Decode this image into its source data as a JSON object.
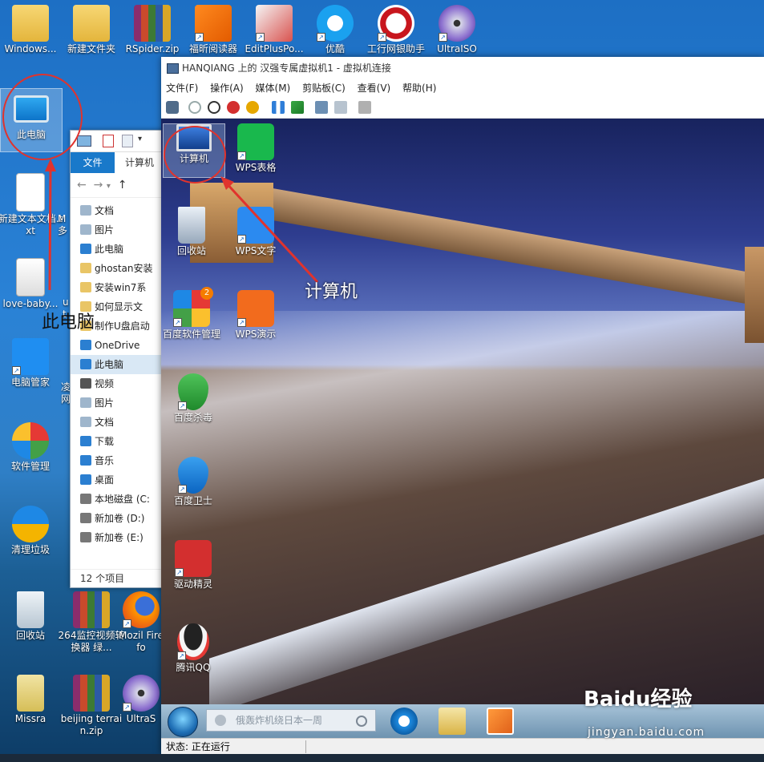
{
  "host_desktop": {
    "icons": [
      {
        "label": "Windows...",
        "icon": "folder-icon"
      },
      {
        "label": "新建文件夹",
        "icon": "folder-icon"
      },
      {
        "label": "RSpider.zip",
        "icon": "winrar-icon"
      },
      {
        "label": "福昕阅读器",
        "icon": "foxit-pdf-icon"
      },
      {
        "label": "EditPlusPo...",
        "icon": "editplus-icon"
      },
      {
        "label": "优酷",
        "icon": "youku-icon"
      },
      {
        "label": "工行网银助手",
        "icon": "icbc-icon"
      },
      {
        "label": "UltraISO",
        "icon": "ultraiso-icon"
      },
      {
        "label": "此电脑",
        "icon": "this-pc-icon"
      },
      {
        "label": "新建文本文档.txt",
        "icon": "text-file-icon"
      },
      {
        "label": "love-baby...",
        "icon": "document-icon"
      },
      {
        "label": "电脑管家",
        "icon": "pc-manager-icon"
      },
      {
        "label": "软件管理",
        "icon": "software-manager-icon"
      },
      {
        "label": "清理垃圾",
        "icon": "cleanup-icon"
      },
      {
        "label": "回收站",
        "icon": "recycle-bin-icon"
      },
      {
        "label": "264监控视频转换器 绿...",
        "icon": "winrar-icon"
      },
      {
        "label": "Mozil Firefo",
        "icon": "firefox-icon"
      },
      {
        "label": "Missra",
        "icon": "archive-icon"
      },
      {
        "label": "beijing terrain.zip",
        "icon": "winrar-icon"
      },
      {
        "label": "UltraS",
        "icon": "ultraiso-icon"
      }
    ],
    "partial_labels": {
      "m1": "M",
      "m2": "多",
      "m3": "ut",
      "m4": "凌",
      "m5": "网"
    }
  },
  "explorer": {
    "tab_file": "文件",
    "tab_computer": "计算机",
    "tree": [
      {
        "label": "文档",
        "color": "#9fb6cc"
      },
      {
        "label": "图片",
        "color": "#9fb6cc"
      },
      {
        "label": "此电脑",
        "color": "#2b7fd1"
      },
      {
        "label": "ghostan安装",
        "color": "#e9c566"
      },
      {
        "label": "安装win7系",
        "color": "#e9c566"
      },
      {
        "label": "如何显示文",
        "color": "#e9c566"
      },
      {
        "label": "制作U盘启动",
        "color": "#e9c566"
      },
      {
        "label": "OneDrive",
        "color": "#2b7fd1"
      },
      {
        "label": "此电脑",
        "color": "#2b7fd1"
      },
      {
        "label": "视频",
        "color": "#555"
      },
      {
        "label": "图片",
        "color": "#9fb6cc"
      },
      {
        "label": "文档",
        "color": "#9fb6cc"
      },
      {
        "label": "下载",
        "color": "#2b7fd1"
      },
      {
        "label": "音乐",
        "color": "#2b7fd1"
      },
      {
        "label": "桌面",
        "color": "#2b7fd1"
      },
      {
        "label": "本地磁盘 (C:",
        "color": "#777"
      },
      {
        "label": "新加卷 (D:)",
        "color": "#777"
      },
      {
        "label": "新加卷 (E:)",
        "color": "#777"
      }
    ],
    "status": "12 个项目"
  },
  "vm": {
    "title": "HANQIANG 上的 汉强专属虚拟机1 - 虚拟机连接",
    "menu": [
      "文件(F)",
      "操作(A)",
      "媒体(M)",
      "剪贴板(C)",
      "查看(V)",
      "帮助(H)"
    ],
    "guest_icons": [
      {
        "label": "计算机",
        "icon": "computer-icon"
      },
      {
        "label": "WPS表格",
        "icon": "wps-spreadsheet-icon"
      },
      {
        "label": "回收站",
        "icon": "recycle-bin-icon"
      },
      {
        "label": "WPS文字",
        "icon": "wps-writer-icon"
      },
      {
        "label": "百度软件管理",
        "icon": "baidu-software-icon"
      },
      {
        "label": "WPS演示",
        "icon": "wps-presentation-icon"
      },
      {
        "label": "百度杀毒",
        "icon": "baidu-antivirus-icon"
      },
      {
        "label": "百度卫士",
        "icon": "baidu-guard-icon"
      },
      {
        "label": "驱动精灵",
        "icon": "driver-genius-icon"
      },
      {
        "label": "腾讯QQ",
        "icon": "qq-icon"
      }
    ],
    "badge": "2",
    "search_placeholder": "俄轰炸机绕日本一周",
    "status": "状态: 正在运行"
  },
  "annotations": {
    "host_label": "此电脑",
    "guest_label": "计算机",
    "color": "#e0332d"
  },
  "watermark": {
    "text": "Baidu经验",
    "url": "jingyan.baidu.com"
  }
}
